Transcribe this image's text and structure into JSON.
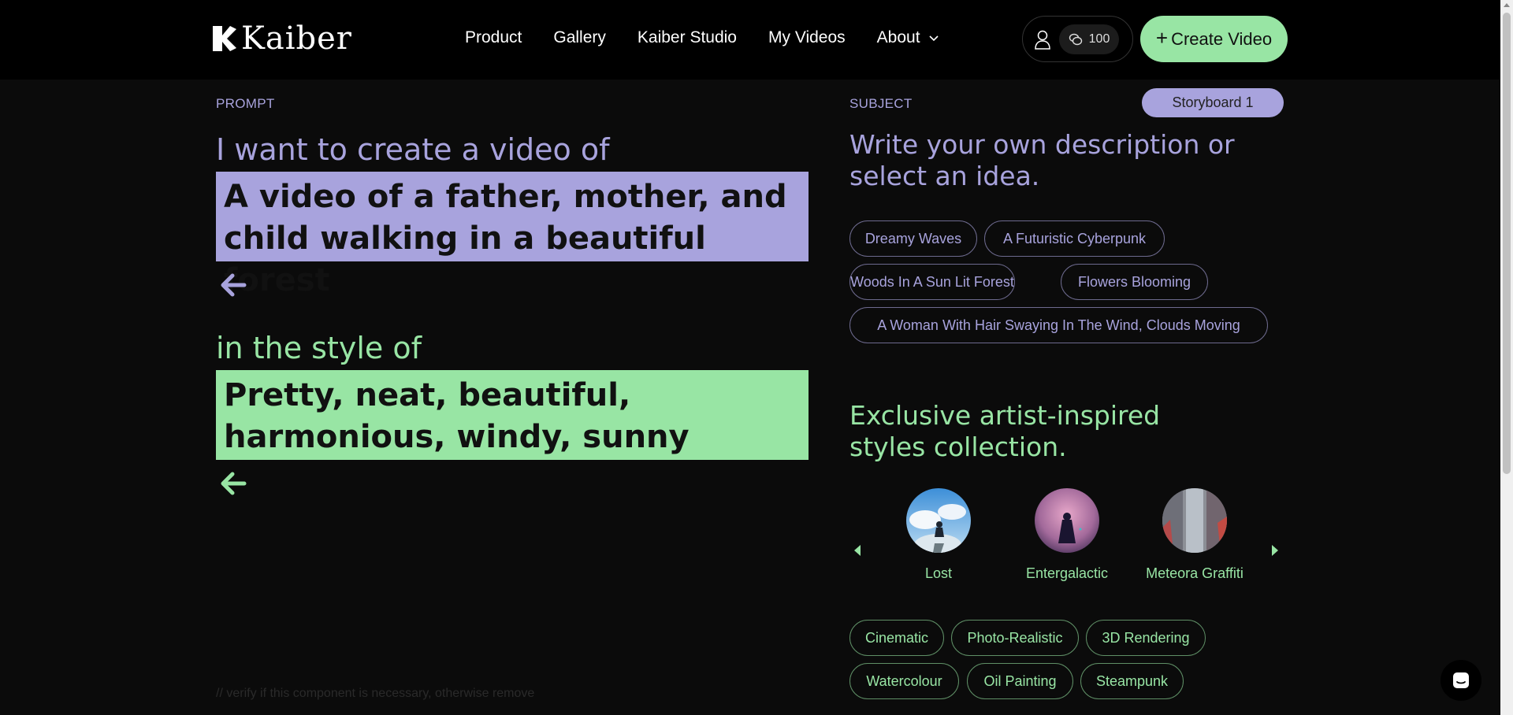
{
  "header": {
    "logo_text": "Kaiber",
    "nav": [
      {
        "label": "Product"
      },
      {
        "label": "Gallery"
      },
      {
        "label": "Kaiber Studio"
      },
      {
        "label": "My Videos"
      },
      {
        "label": "About"
      }
    ],
    "credits": "100",
    "create_button": "Create Video"
  },
  "prompt": {
    "label": "PROMPT",
    "intro": "I want to create a video of",
    "subject_text": "A video of a father, mother, and child walking in a beautiful forest",
    "style_intro": "in the style of",
    "style_text": "Pretty, neat, beautiful, harmonious, windy, sunny",
    "comment": "// verify if this component is necessary, otherwise remove"
  },
  "subject": {
    "label": "SUBJECT",
    "storyboard_button": "Storyboard 1",
    "heading": "Write your own description or select an idea.",
    "ideas": [
      "Dreamy Waves",
      "A Futuristic Cyberpunk",
      "Woods In A Sun Lit Forest",
      "Flowers Blooming",
      "A Woman With Hair Swaying In The Wind, Clouds Moving"
    ]
  },
  "styles": {
    "heading_line1": "Exclusive artist-inspired",
    "heading_line2": "styles collection.",
    "artists": [
      {
        "name": "Lost"
      },
      {
        "name": "Entergalactic"
      },
      {
        "name": "Meteora Graffiti"
      }
    ],
    "tags": [
      "Cinematic",
      "Photo-Realistic",
      "3D Rendering",
      "Watercolour",
      "Oil Painting",
      "Steampunk"
    ]
  },
  "colors": {
    "purple": "#a8a3dd",
    "green": "#98e5a4",
    "background": "#0b0b0b"
  }
}
